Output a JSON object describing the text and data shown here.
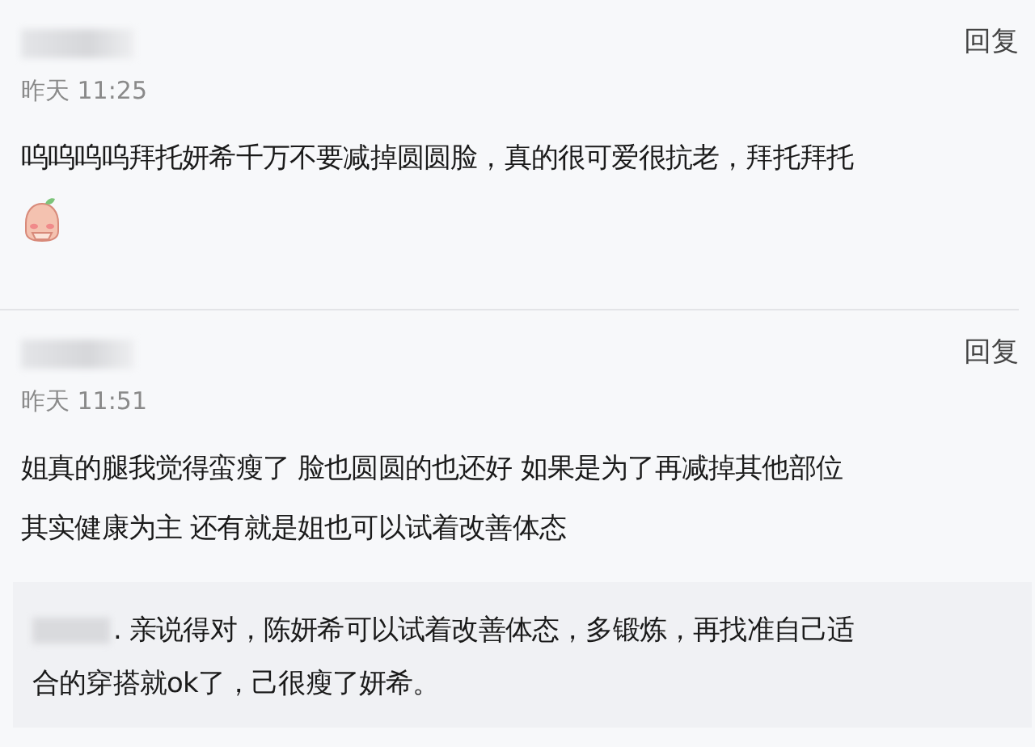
{
  "comments": [
    {
      "reply_label": "回复",
      "time": "昨天 11:25",
      "text": "呜呜呜呜拜托妍希千万不要减掉圆圆脸，真的很可爱很抗老，拜托拜托",
      "has_emoji": true
    },
    {
      "reply_label": "回复",
      "time": "昨天 11:51",
      "lines": [
        "姐真的腿我觉得蛮瘦了 脸也圆圆的也还好 如果是为了再减掉其他部位",
        "其实健康为主 还有就是姐也可以试着改善体态"
      ],
      "has_emoji": false,
      "reply": {
        "lines": [
          ". 亲说得对，陈妍希可以试着改善体态，多锻炼，再找准自己适",
          "合的穿搭就ok了，己很瘦了妍希。"
        ]
      }
    }
  ]
}
